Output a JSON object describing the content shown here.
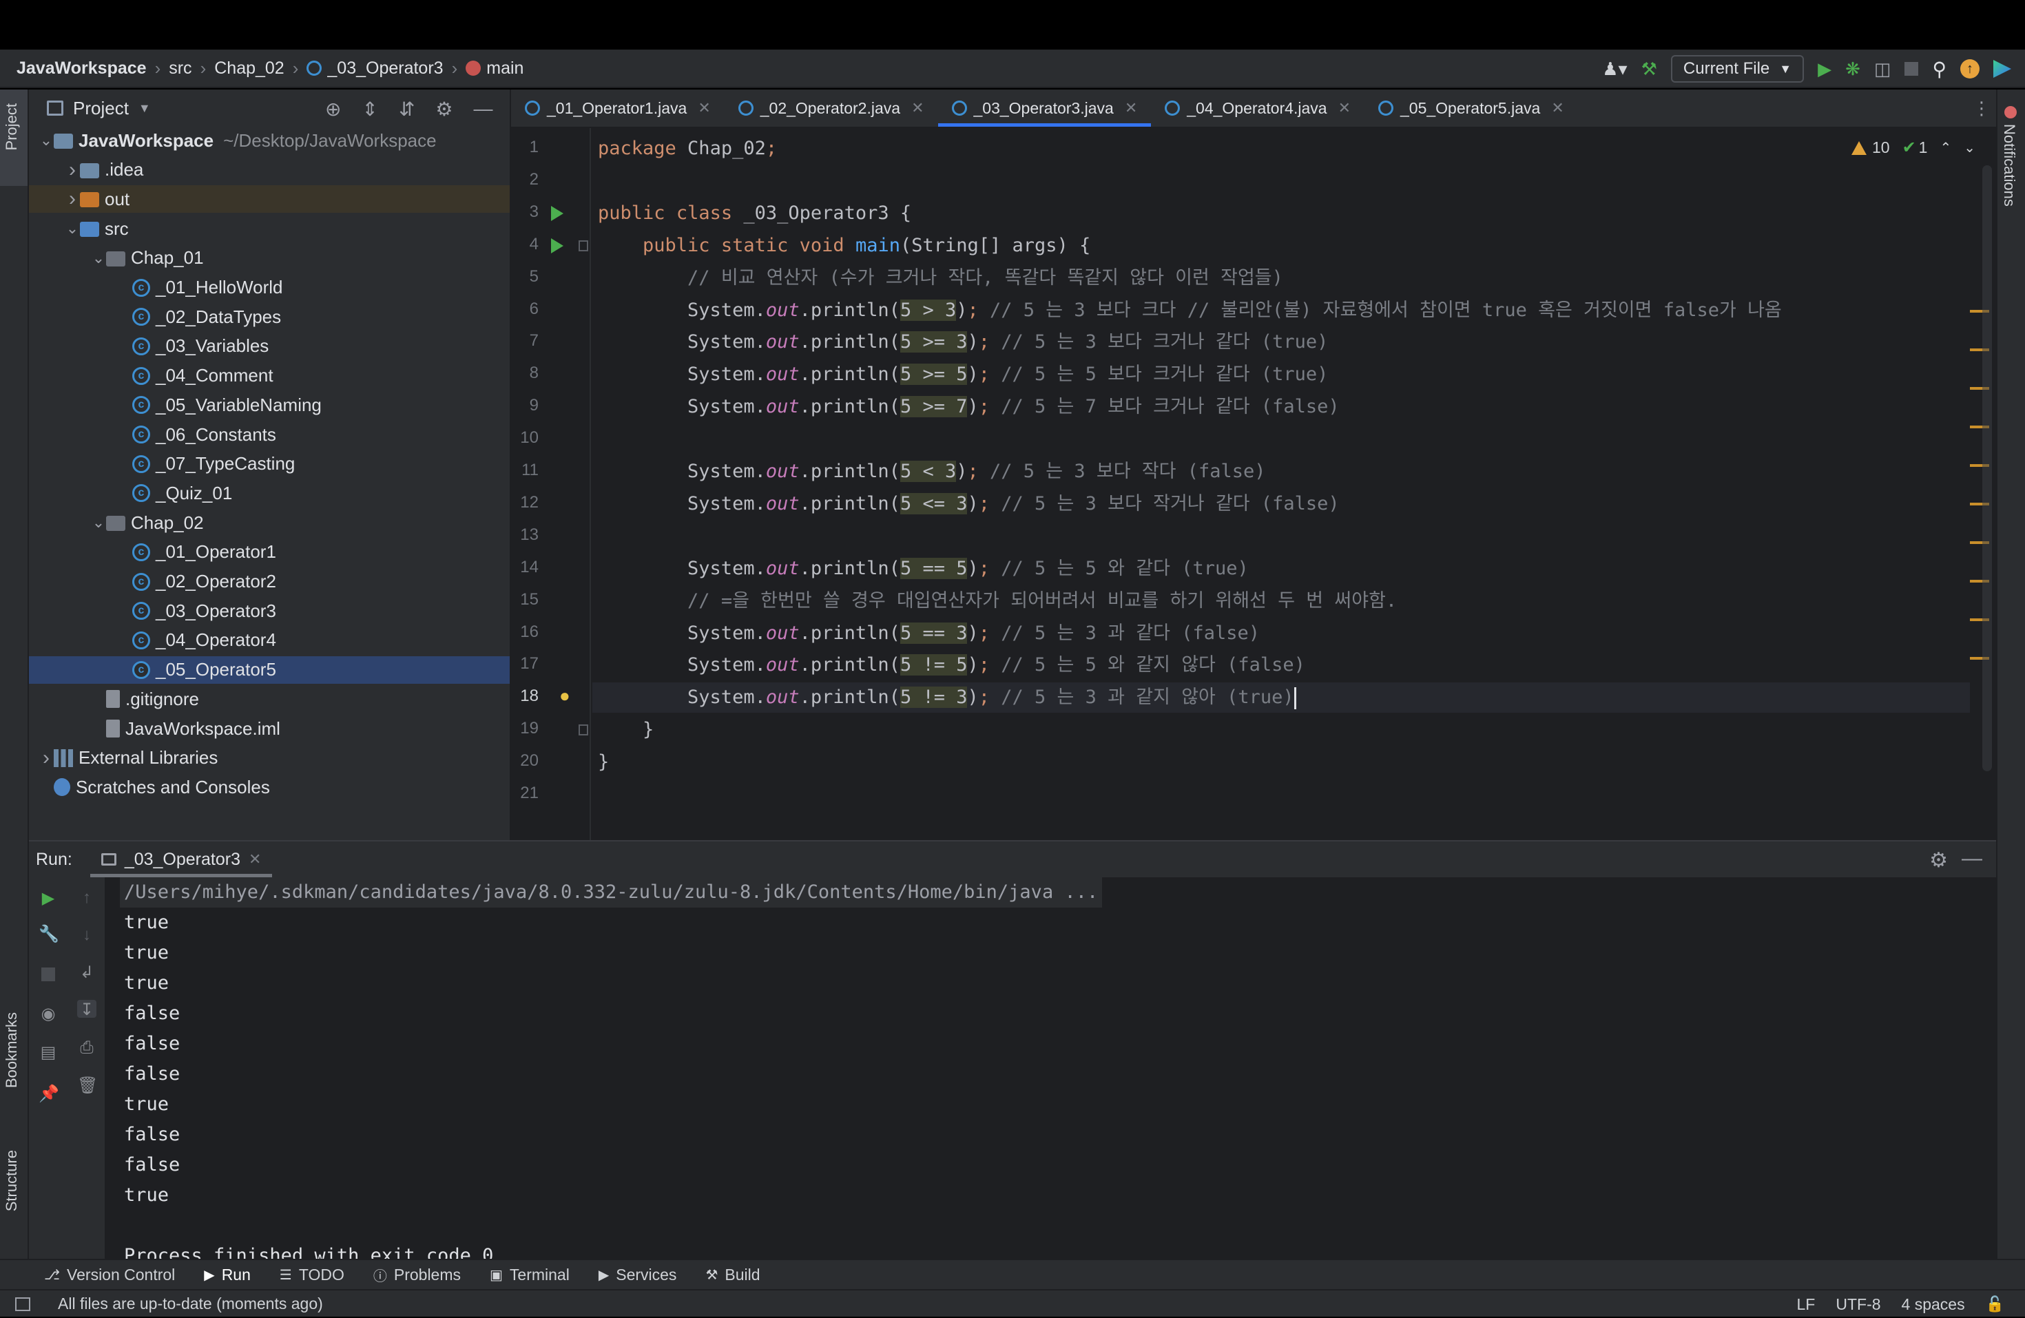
{
  "breadcrumb": [
    {
      "label": "JavaWorkspace",
      "bold": true
    },
    {
      "label": "src"
    },
    {
      "label": "Chap_02"
    },
    {
      "label": "_03_Operator3",
      "icon": "class-icon"
    },
    {
      "label": "main",
      "icon": "method-icon"
    }
  ],
  "toolbar": {
    "run_config": "Current File"
  },
  "project_panel": {
    "title": "Project",
    "tree": [
      {
        "label": "JavaWorkspace",
        "path": "~/Desktop/JavaWorkspace",
        "depth": 0,
        "icon": "module",
        "expanded": true,
        "bold": true
      },
      {
        "label": ".idea",
        "depth": 1,
        "icon": "folder",
        "expanded": false
      },
      {
        "label": "out",
        "depth": 1,
        "icon": "folder-orange",
        "expanded": false,
        "excluded": true
      },
      {
        "label": "src",
        "depth": 1,
        "icon": "folder-blue",
        "expanded": true
      },
      {
        "label": "Chap_01",
        "depth": 2,
        "icon": "package",
        "expanded": true
      },
      {
        "label": "_01_HelloWorld",
        "depth": 3,
        "icon": "class"
      },
      {
        "label": "_02_DataTypes",
        "depth": 3,
        "icon": "class"
      },
      {
        "label": "_03_Variables",
        "depth": 3,
        "icon": "class"
      },
      {
        "label": "_04_Comment",
        "depth": 3,
        "icon": "class"
      },
      {
        "label": "_05_VariableNaming",
        "depth": 3,
        "icon": "class"
      },
      {
        "label": "_06_Constants",
        "depth": 3,
        "icon": "class"
      },
      {
        "label": "_07_TypeCasting",
        "depth": 3,
        "icon": "class"
      },
      {
        "label": "_Quiz_01",
        "depth": 3,
        "icon": "class"
      },
      {
        "label": "Chap_02",
        "depth": 2,
        "icon": "package",
        "expanded": true
      },
      {
        "label": "_01_Operator1",
        "depth": 3,
        "icon": "class"
      },
      {
        "label": "_02_Operator2",
        "depth": 3,
        "icon": "class"
      },
      {
        "label": "_03_Operator3",
        "depth": 3,
        "icon": "class"
      },
      {
        "label": "_04_Operator4",
        "depth": 3,
        "icon": "class"
      },
      {
        "label": "_05_Operator5",
        "depth": 3,
        "icon": "class",
        "selected": true
      },
      {
        "label": ".gitignore",
        "depth": 2,
        "icon": "file"
      },
      {
        "label": "JavaWorkspace.iml",
        "depth": 2,
        "icon": "file"
      },
      {
        "label": "External Libraries",
        "depth": 0,
        "icon": "library",
        "expanded": false
      },
      {
        "label": "Scratches and Consoles",
        "depth": 0,
        "icon": "scratch"
      }
    ]
  },
  "editor": {
    "tabs": [
      {
        "label": "_01_Operator1.java"
      },
      {
        "label": "_02_Operator2.java"
      },
      {
        "label": "_03_Operator3.java",
        "active": true
      },
      {
        "label": "_04_Operator4.java"
      },
      {
        "label": "_05_Operator5.java"
      }
    ],
    "inspections": {
      "warnings": "10",
      "ok": "1"
    },
    "current_line": 18,
    "lines": [
      "package Chap_02;",
      "",
      "public class _03_Operator3 {",
      "    public static void main(String[] args) {",
      "        // 비교 연산자 (수가 크거나 작다, 똑같다 똑같지 않다 이런 작업들)",
      "        System.out.println(5 > 3); // 5 는 3 보다 크다 // 불리안(불) 자료형에서 참이면 true 혹은 거짓이면 false가 나옴",
      "        System.out.println(5 >= 3); // 5 는 3 보다 크거나 같다 (true)",
      "        System.out.println(5 >= 5); // 5 는 5 보다 크거나 같다 (true)",
      "        System.out.println(5 >= 7); // 5 는 7 보다 크거나 같다 (false)",
      "",
      "        System.out.println(5 < 3); // 5 는 3 보다 작다 (false)",
      "        System.out.println(5 <= 3); // 5 는 3 보다 작거나 같다 (false)",
      "",
      "        System.out.println(5 == 5); // 5 는 5 와 같다 (true)",
      "        // =을 한번만 쓸 경우 대입연산자가 되어버려서 비교를 하기 위해선 두 번 써야함.",
      "        System.out.println(5 == 3); // 5 는 3 과 같다 (false)",
      "        System.out.println(5 != 5); // 5 는 5 와 같지 않다 (false)",
      "        System.out.println(5 != 3); // 5 는 3 과 같지 않아 (true)",
      "    }",
      "}",
      ""
    ]
  },
  "run_panel": {
    "label": "Run:",
    "tab": "_03_Operator3",
    "command": "/Users/mihye/.sdkman/candidates/java/8.0.332-zulu/zulu-8.jdk/Contents/Home/bin/java ...",
    "output": [
      "true",
      "true",
      "true",
      "false",
      "false",
      "false",
      "true",
      "false",
      "false",
      "true",
      "",
      "Process finished with exit code 0"
    ]
  },
  "tool_windows": [
    {
      "label": "Version Control",
      "icon": "branch-icon"
    },
    {
      "label": "Run",
      "icon": "play-icon",
      "active": true
    },
    {
      "label": "TODO",
      "icon": "list-icon"
    },
    {
      "label": "Problems",
      "icon": "problems-icon"
    },
    {
      "label": "Terminal",
      "icon": "terminal-icon"
    },
    {
      "label": "Services",
      "icon": "services-icon"
    },
    {
      "label": "Build",
      "icon": "hammer-icon"
    }
  ],
  "side_tabs": {
    "left_top": "Project",
    "left_bottom1": "Bookmarks",
    "left_bottom2": "Structure",
    "right": "Notifications"
  },
  "status": {
    "message": "All files are up-to-date (moments ago)",
    "line_sep": "LF",
    "encoding": "UTF-8",
    "indent": "4 spaces"
  },
  "colors": {
    "accent": "#3574f0",
    "selection": "#2e436e",
    "run_green": "#4cae4f",
    "warning": "#e0a23a"
  }
}
